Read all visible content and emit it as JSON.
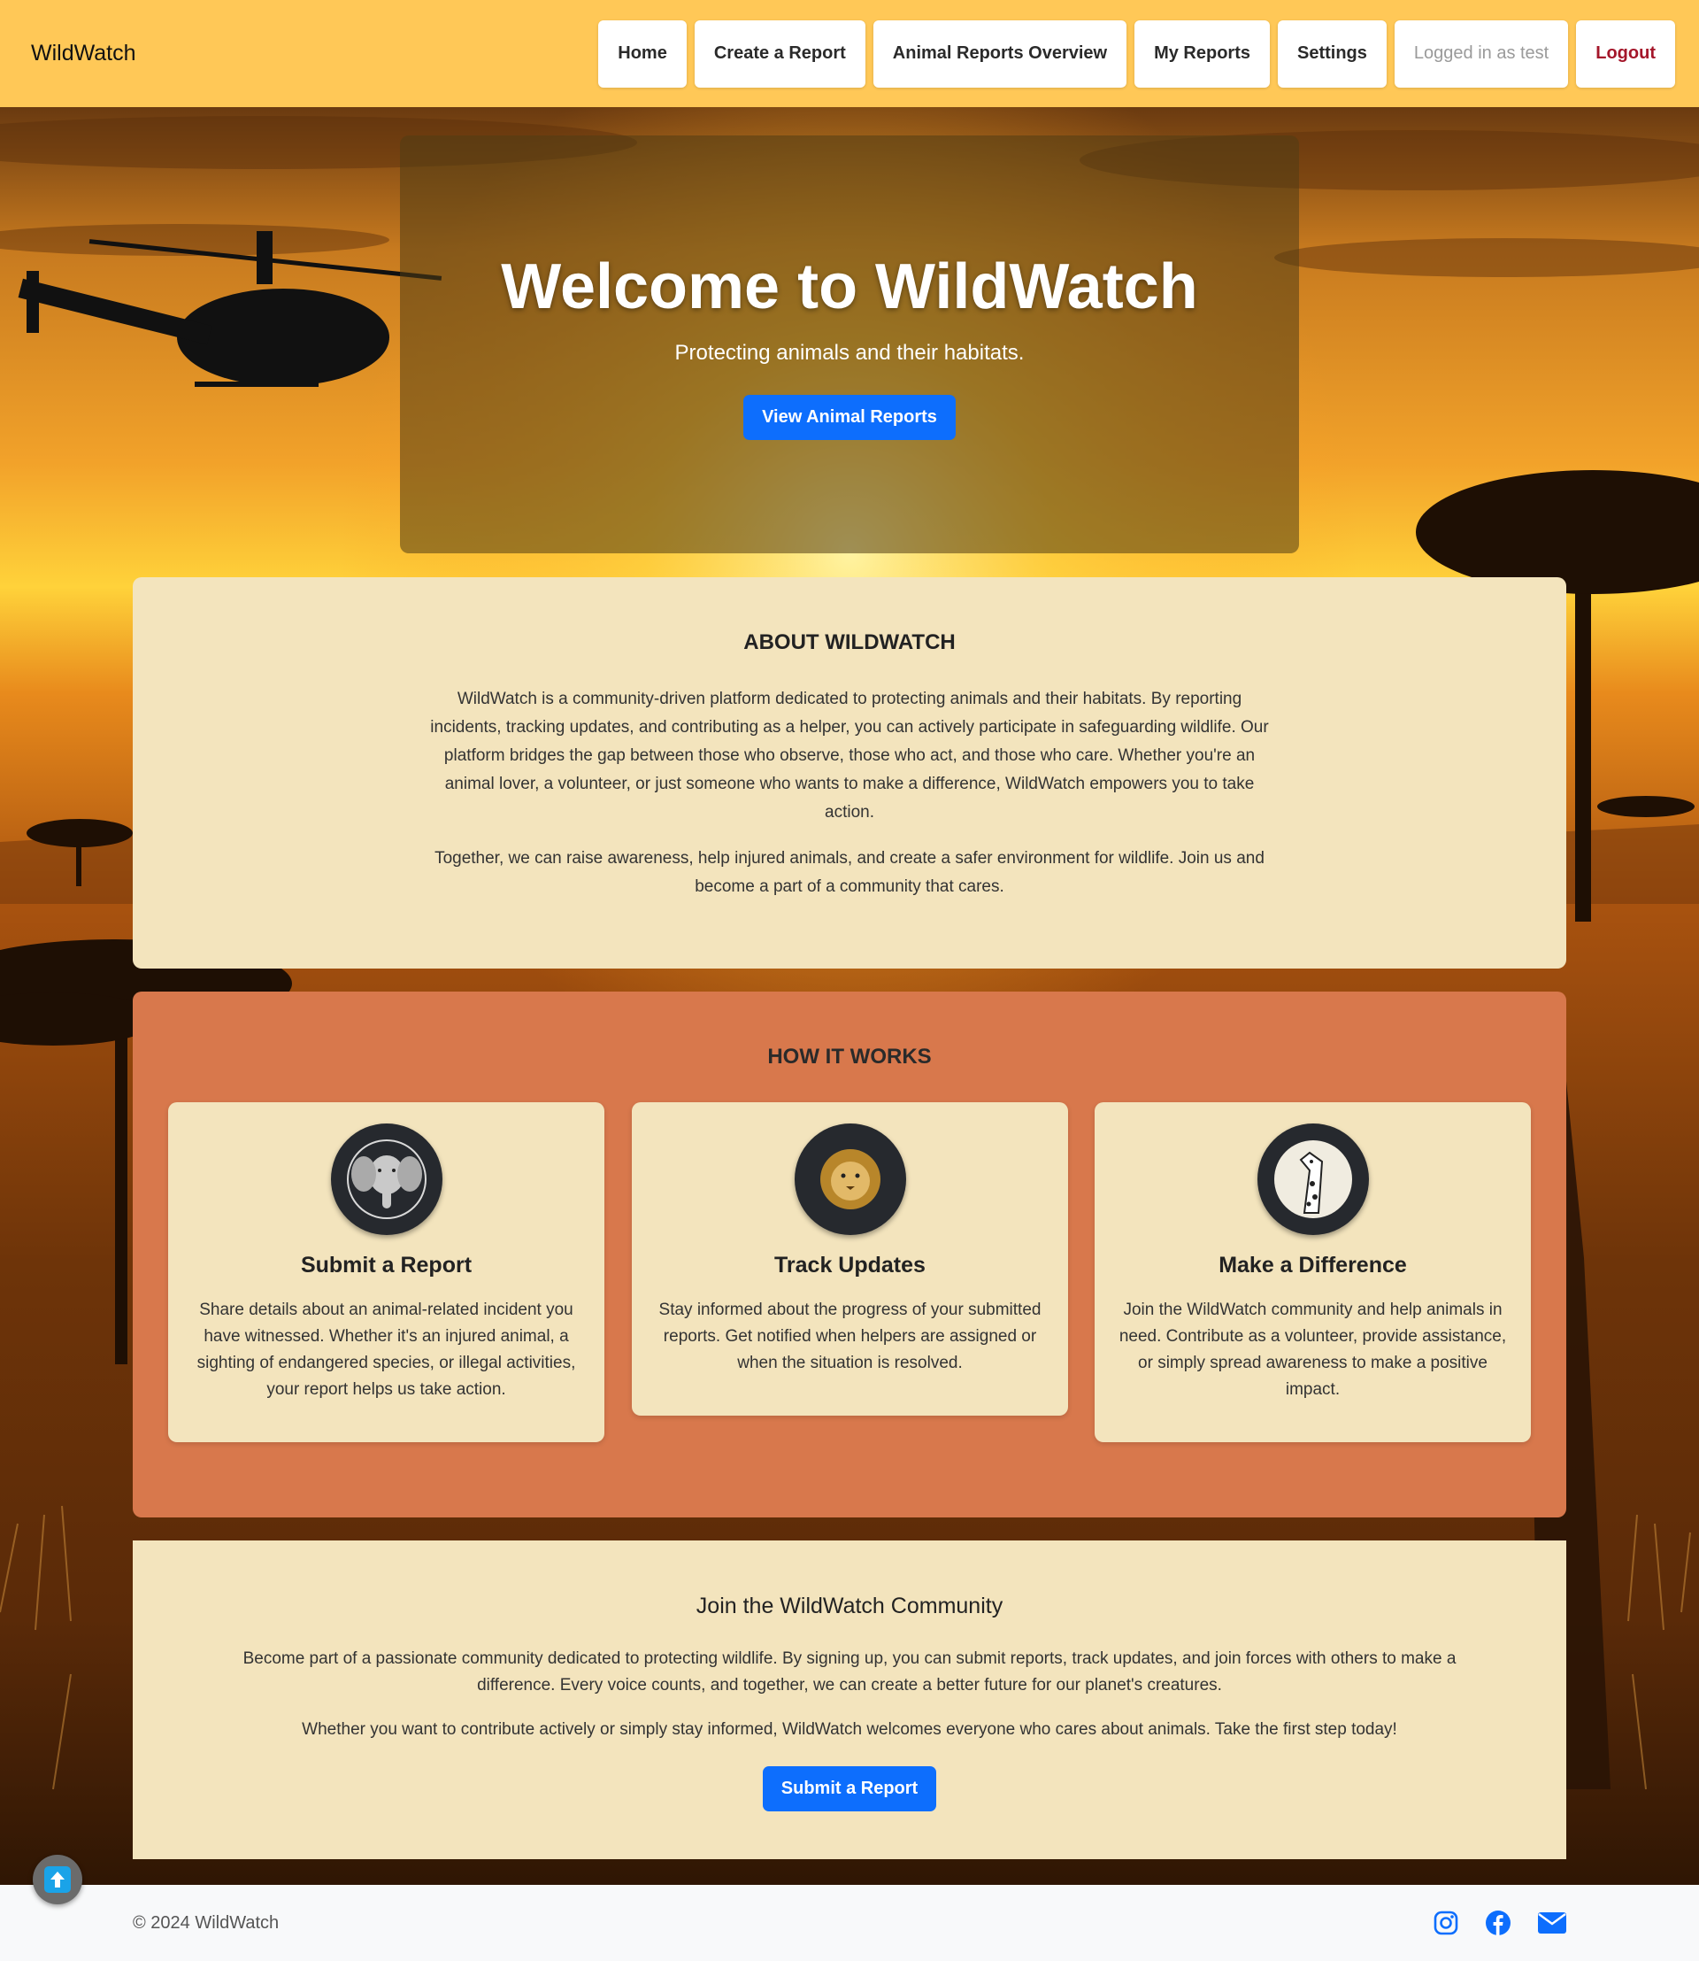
{
  "navbar": {
    "brand": "WildWatch",
    "links": [
      {
        "label": "Home"
      },
      {
        "label": "Create a Report"
      },
      {
        "label": "Animal Reports Overview"
      },
      {
        "label": "My Reports"
      },
      {
        "label": "Settings"
      }
    ],
    "logged_in_text": "Logged in as test",
    "logout_label": "Logout"
  },
  "hero": {
    "title": "Welcome to WildWatch",
    "subtitle": "Protecting animals and their habitats.",
    "cta_label": "View Animal Reports"
  },
  "about": {
    "heading": "ABOUT WILDWATCH",
    "paragraph1": "WildWatch is a community-driven platform dedicated to protecting animals and their habitats. By reporting incidents, tracking updates, and contributing as a helper, you can actively participate in safeguarding wildlife. Our platform bridges the gap between those who observe, those who act, and those who care. Whether you're an animal lover, a volunteer, or just someone who wants to make a difference, WildWatch empowers you to take action.",
    "paragraph2": "Together, we can raise awareness, help injured animals, and create a safer environment for wildlife. Join us and become a part of a community that cares."
  },
  "how_it_works": {
    "heading": "HOW IT WORKS",
    "cards": [
      {
        "icon": "elephant-icon",
        "title": "Submit a Report",
        "text": "Share details about an animal-related incident you have witnessed. Whether it's an injured animal, a sighting of endangered species, or illegal activities, your report helps us take action."
      },
      {
        "icon": "lion-icon",
        "title": "Track Updates",
        "text": "Stay informed about the progress of your submitted reports. Get notified when helpers are assigned or when the situation is resolved."
      },
      {
        "icon": "giraffe-icon",
        "title": "Make a Difference",
        "text": "Join the WildWatch community and help animals in need. Contribute as a volunteer, provide assistance, or simply spread awareness to make a positive impact."
      }
    ]
  },
  "join": {
    "heading": "Join the WildWatch Community",
    "paragraph1": "Become part of a passionate community dedicated to protecting wildlife. By signing up, you can submit reports, track updates, and join forces with others to make a difference. Every voice counts, and together, we can create a better future for our planet's creatures.",
    "paragraph2": "Whether you want to contribute actively or simply stay informed, WildWatch welcomes everyone who cares about animals. Take the first step today!",
    "cta_label": "Submit a Report"
  },
  "footer": {
    "copyright": "© 2024 WildWatch",
    "social": [
      "instagram-icon",
      "facebook-icon",
      "email-icon"
    ]
  },
  "colors": {
    "navbar": "#ffc857",
    "primary": "#0d6efd",
    "section_light": "#f3e4bd",
    "section_accent": "#d8784c",
    "logout": "#a4162a"
  }
}
